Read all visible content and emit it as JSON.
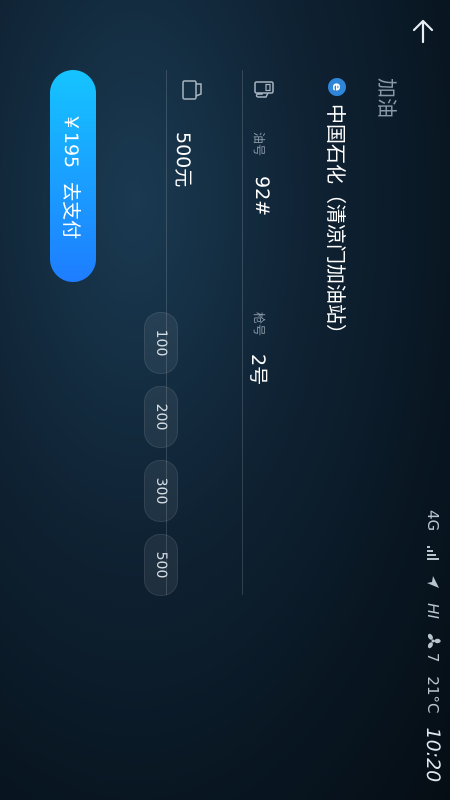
{
  "header": {
    "title": "加油"
  },
  "status_bar": {
    "network": "4G",
    "nav": "HI",
    "fan_level": "7",
    "temperature": "21°C",
    "time": "10:20"
  },
  "station": {
    "logo_letter": "e",
    "name": "中国石化（清凉门加油站）"
  },
  "fuel": {
    "label": "油号",
    "value": "92#"
  },
  "nozzle": {
    "label": "枪号",
    "value": "2号"
  },
  "amount": {
    "value": "500元"
  },
  "amount_options": [
    "100",
    "200",
    "300",
    "500"
  ],
  "pay": {
    "price": "￥195",
    "label": "去支付"
  }
}
